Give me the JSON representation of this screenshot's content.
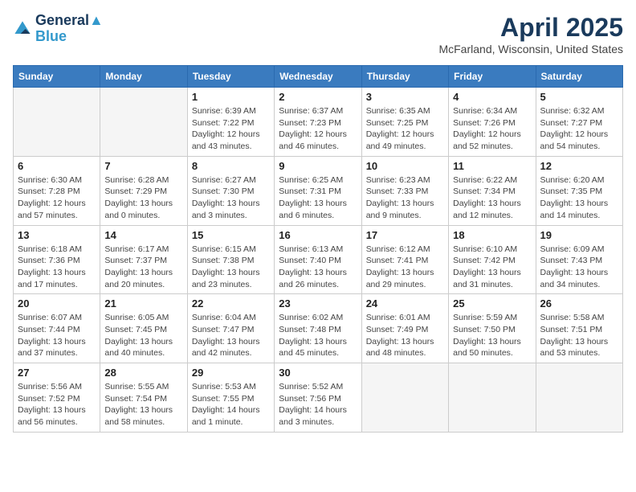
{
  "header": {
    "logo_line1": "General",
    "logo_line2": "Blue",
    "title": "April 2025",
    "subtitle": "McFarland, Wisconsin, United States"
  },
  "calendar": {
    "days_of_week": [
      "Sunday",
      "Monday",
      "Tuesday",
      "Wednesday",
      "Thursday",
      "Friday",
      "Saturday"
    ],
    "weeks": [
      [
        {
          "day": "",
          "info": ""
        },
        {
          "day": "",
          "info": ""
        },
        {
          "day": "1",
          "info": "Sunrise: 6:39 AM\nSunset: 7:22 PM\nDaylight: 12 hours\nand 43 minutes."
        },
        {
          "day": "2",
          "info": "Sunrise: 6:37 AM\nSunset: 7:23 PM\nDaylight: 12 hours\nand 46 minutes."
        },
        {
          "day": "3",
          "info": "Sunrise: 6:35 AM\nSunset: 7:25 PM\nDaylight: 12 hours\nand 49 minutes."
        },
        {
          "day": "4",
          "info": "Sunrise: 6:34 AM\nSunset: 7:26 PM\nDaylight: 12 hours\nand 52 minutes."
        },
        {
          "day": "5",
          "info": "Sunrise: 6:32 AM\nSunset: 7:27 PM\nDaylight: 12 hours\nand 54 minutes."
        }
      ],
      [
        {
          "day": "6",
          "info": "Sunrise: 6:30 AM\nSunset: 7:28 PM\nDaylight: 12 hours\nand 57 minutes."
        },
        {
          "day": "7",
          "info": "Sunrise: 6:28 AM\nSunset: 7:29 PM\nDaylight: 13 hours\nand 0 minutes."
        },
        {
          "day": "8",
          "info": "Sunrise: 6:27 AM\nSunset: 7:30 PM\nDaylight: 13 hours\nand 3 minutes."
        },
        {
          "day": "9",
          "info": "Sunrise: 6:25 AM\nSunset: 7:31 PM\nDaylight: 13 hours\nand 6 minutes."
        },
        {
          "day": "10",
          "info": "Sunrise: 6:23 AM\nSunset: 7:33 PM\nDaylight: 13 hours\nand 9 minutes."
        },
        {
          "day": "11",
          "info": "Sunrise: 6:22 AM\nSunset: 7:34 PM\nDaylight: 13 hours\nand 12 minutes."
        },
        {
          "day": "12",
          "info": "Sunrise: 6:20 AM\nSunset: 7:35 PM\nDaylight: 13 hours\nand 14 minutes."
        }
      ],
      [
        {
          "day": "13",
          "info": "Sunrise: 6:18 AM\nSunset: 7:36 PM\nDaylight: 13 hours\nand 17 minutes."
        },
        {
          "day": "14",
          "info": "Sunrise: 6:17 AM\nSunset: 7:37 PM\nDaylight: 13 hours\nand 20 minutes."
        },
        {
          "day": "15",
          "info": "Sunrise: 6:15 AM\nSunset: 7:38 PM\nDaylight: 13 hours\nand 23 minutes."
        },
        {
          "day": "16",
          "info": "Sunrise: 6:13 AM\nSunset: 7:40 PM\nDaylight: 13 hours\nand 26 minutes."
        },
        {
          "day": "17",
          "info": "Sunrise: 6:12 AM\nSunset: 7:41 PM\nDaylight: 13 hours\nand 29 minutes."
        },
        {
          "day": "18",
          "info": "Sunrise: 6:10 AM\nSunset: 7:42 PM\nDaylight: 13 hours\nand 31 minutes."
        },
        {
          "day": "19",
          "info": "Sunrise: 6:09 AM\nSunset: 7:43 PM\nDaylight: 13 hours\nand 34 minutes."
        }
      ],
      [
        {
          "day": "20",
          "info": "Sunrise: 6:07 AM\nSunset: 7:44 PM\nDaylight: 13 hours\nand 37 minutes."
        },
        {
          "day": "21",
          "info": "Sunrise: 6:05 AM\nSunset: 7:45 PM\nDaylight: 13 hours\nand 40 minutes."
        },
        {
          "day": "22",
          "info": "Sunrise: 6:04 AM\nSunset: 7:47 PM\nDaylight: 13 hours\nand 42 minutes."
        },
        {
          "day": "23",
          "info": "Sunrise: 6:02 AM\nSunset: 7:48 PM\nDaylight: 13 hours\nand 45 minutes."
        },
        {
          "day": "24",
          "info": "Sunrise: 6:01 AM\nSunset: 7:49 PM\nDaylight: 13 hours\nand 48 minutes."
        },
        {
          "day": "25",
          "info": "Sunrise: 5:59 AM\nSunset: 7:50 PM\nDaylight: 13 hours\nand 50 minutes."
        },
        {
          "day": "26",
          "info": "Sunrise: 5:58 AM\nSunset: 7:51 PM\nDaylight: 13 hours\nand 53 minutes."
        }
      ],
      [
        {
          "day": "27",
          "info": "Sunrise: 5:56 AM\nSunset: 7:52 PM\nDaylight: 13 hours\nand 56 minutes."
        },
        {
          "day": "28",
          "info": "Sunrise: 5:55 AM\nSunset: 7:54 PM\nDaylight: 13 hours\nand 58 minutes."
        },
        {
          "day": "29",
          "info": "Sunrise: 5:53 AM\nSunset: 7:55 PM\nDaylight: 14 hours\nand 1 minute."
        },
        {
          "day": "30",
          "info": "Sunrise: 5:52 AM\nSunset: 7:56 PM\nDaylight: 14 hours\nand 3 minutes."
        },
        {
          "day": "",
          "info": ""
        },
        {
          "day": "",
          "info": ""
        },
        {
          "day": "",
          "info": ""
        }
      ]
    ]
  }
}
